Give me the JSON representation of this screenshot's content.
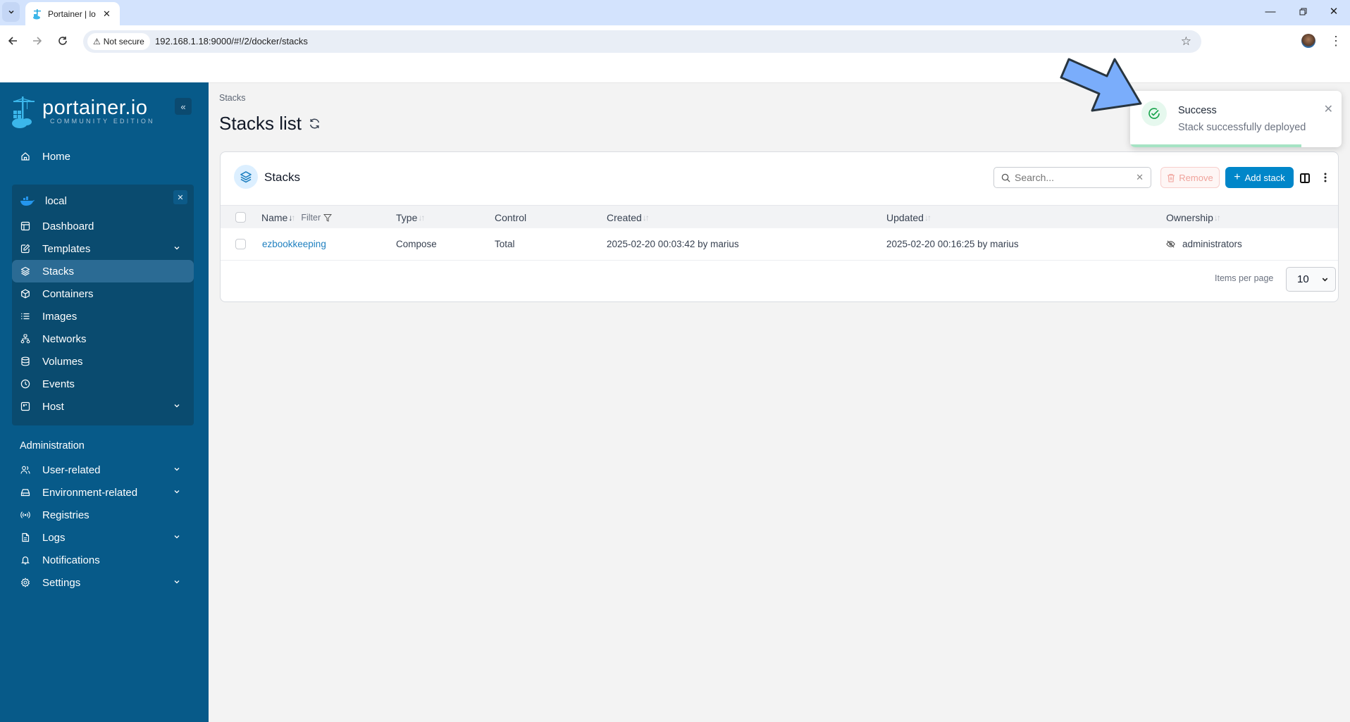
{
  "browser": {
    "tab_title": "Portainer | lo",
    "address": {
      "security_label": "Not secure",
      "url": "192.168.1.18:9000/#!/2/docker/stacks"
    }
  },
  "sidebar": {
    "logo": {
      "main": "portainer.io",
      "sub": "COMMUNITY EDITION"
    },
    "collapse_glyph": "«",
    "home": {
      "label": "Home",
      "icon": "home-icon"
    },
    "environment": {
      "name": "local",
      "icon": "docker-whale-icon",
      "items": [
        {
          "label": "Dashboard",
          "icon": "dashboard-icon",
          "expandable": false,
          "active": false
        },
        {
          "label": "Templates",
          "icon": "edit-icon",
          "expandable": true,
          "active": false
        },
        {
          "label": "Stacks",
          "icon": "layers-icon",
          "expandable": false,
          "active": true
        },
        {
          "label": "Containers",
          "icon": "box-icon",
          "expandable": false,
          "active": false
        },
        {
          "label": "Images",
          "icon": "list-icon",
          "expandable": false,
          "active": false
        },
        {
          "label": "Networks",
          "icon": "network-icon",
          "expandable": false,
          "active": false
        },
        {
          "label": "Volumes",
          "icon": "database-icon",
          "expandable": false,
          "active": false
        },
        {
          "label": "Events",
          "icon": "clock-icon",
          "expandable": false,
          "active": false
        },
        {
          "label": "Host",
          "icon": "host-icon",
          "expandable": true,
          "active": false
        }
      ]
    },
    "admin_heading": "Administration",
    "admin_items": [
      {
        "label": "User-related",
        "icon": "users-icon",
        "expandable": true
      },
      {
        "label": "Environment-related",
        "icon": "hard-drive-icon",
        "expandable": true
      },
      {
        "label": "Registries",
        "icon": "radio-icon",
        "expandable": false
      },
      {
        "label": "Logs",
        "icon": "file-text-icon",
        "expandable": true
      },
      {
        "label": "Notifications",
        "icon": "bell-icon",
        "expandable": false
      },
      {
        "label": "Settings",
        "icon": "gear-icon",
        "expandable": true
      }
    ]
  },
  "main": {
    "breadcrumb": "Stacks",
    "title": "Stacks list",
    "card": {
      "title": "Stacks",
      "search_placeholder": "Search...",
      "search_value": "",
      "remove_label": "Remove",
      "add_label": "Add stack",
      "columns": [
        {
          "label": "Name",
          "sortable": true,
          "sorted": "desc"
        },
        {
          "label": "Type",
          "sortable": true
        },
        {
          "label": "Control",
          "sortable": false
        },
        {
          "label": "Created",
          "sortable": true
        },
        {
          "label": "Updated",
          "sortable": true
        },
        {
          "label": "Ownership",
          "sortable": true
        }
      ],
      "filter_label": "Filter",
      "rows": [
        {
          "name": "ezbookkeeping",
          "type": "Compose",
          "control": "Total",
          "created": "2025-02-20 00:03:42 by marius",
          "updated": "2025-02-20 00:16:25 by marius",
          "ownership": "administrators",
          "ownership_icon": "eye-off-icon"
        }
      ],
      "items_per_page_label": "Items per page",
      "items_per_page": "10"
    }
  },
  "toast": {
    "title": "Success",
    "message": "Stack successfully deployed",
    "progress": 0.81,
    "colors": {
      "icon": "#16a34a",
      "progress": "#a5e3c4"
    }
  },
  "colors": {
    "sidebar": "#075a89",
    "active_item": "#2b6b94",
    "primary_button": "#0086c9",
    "link": "#1f80c0"
  }
}
